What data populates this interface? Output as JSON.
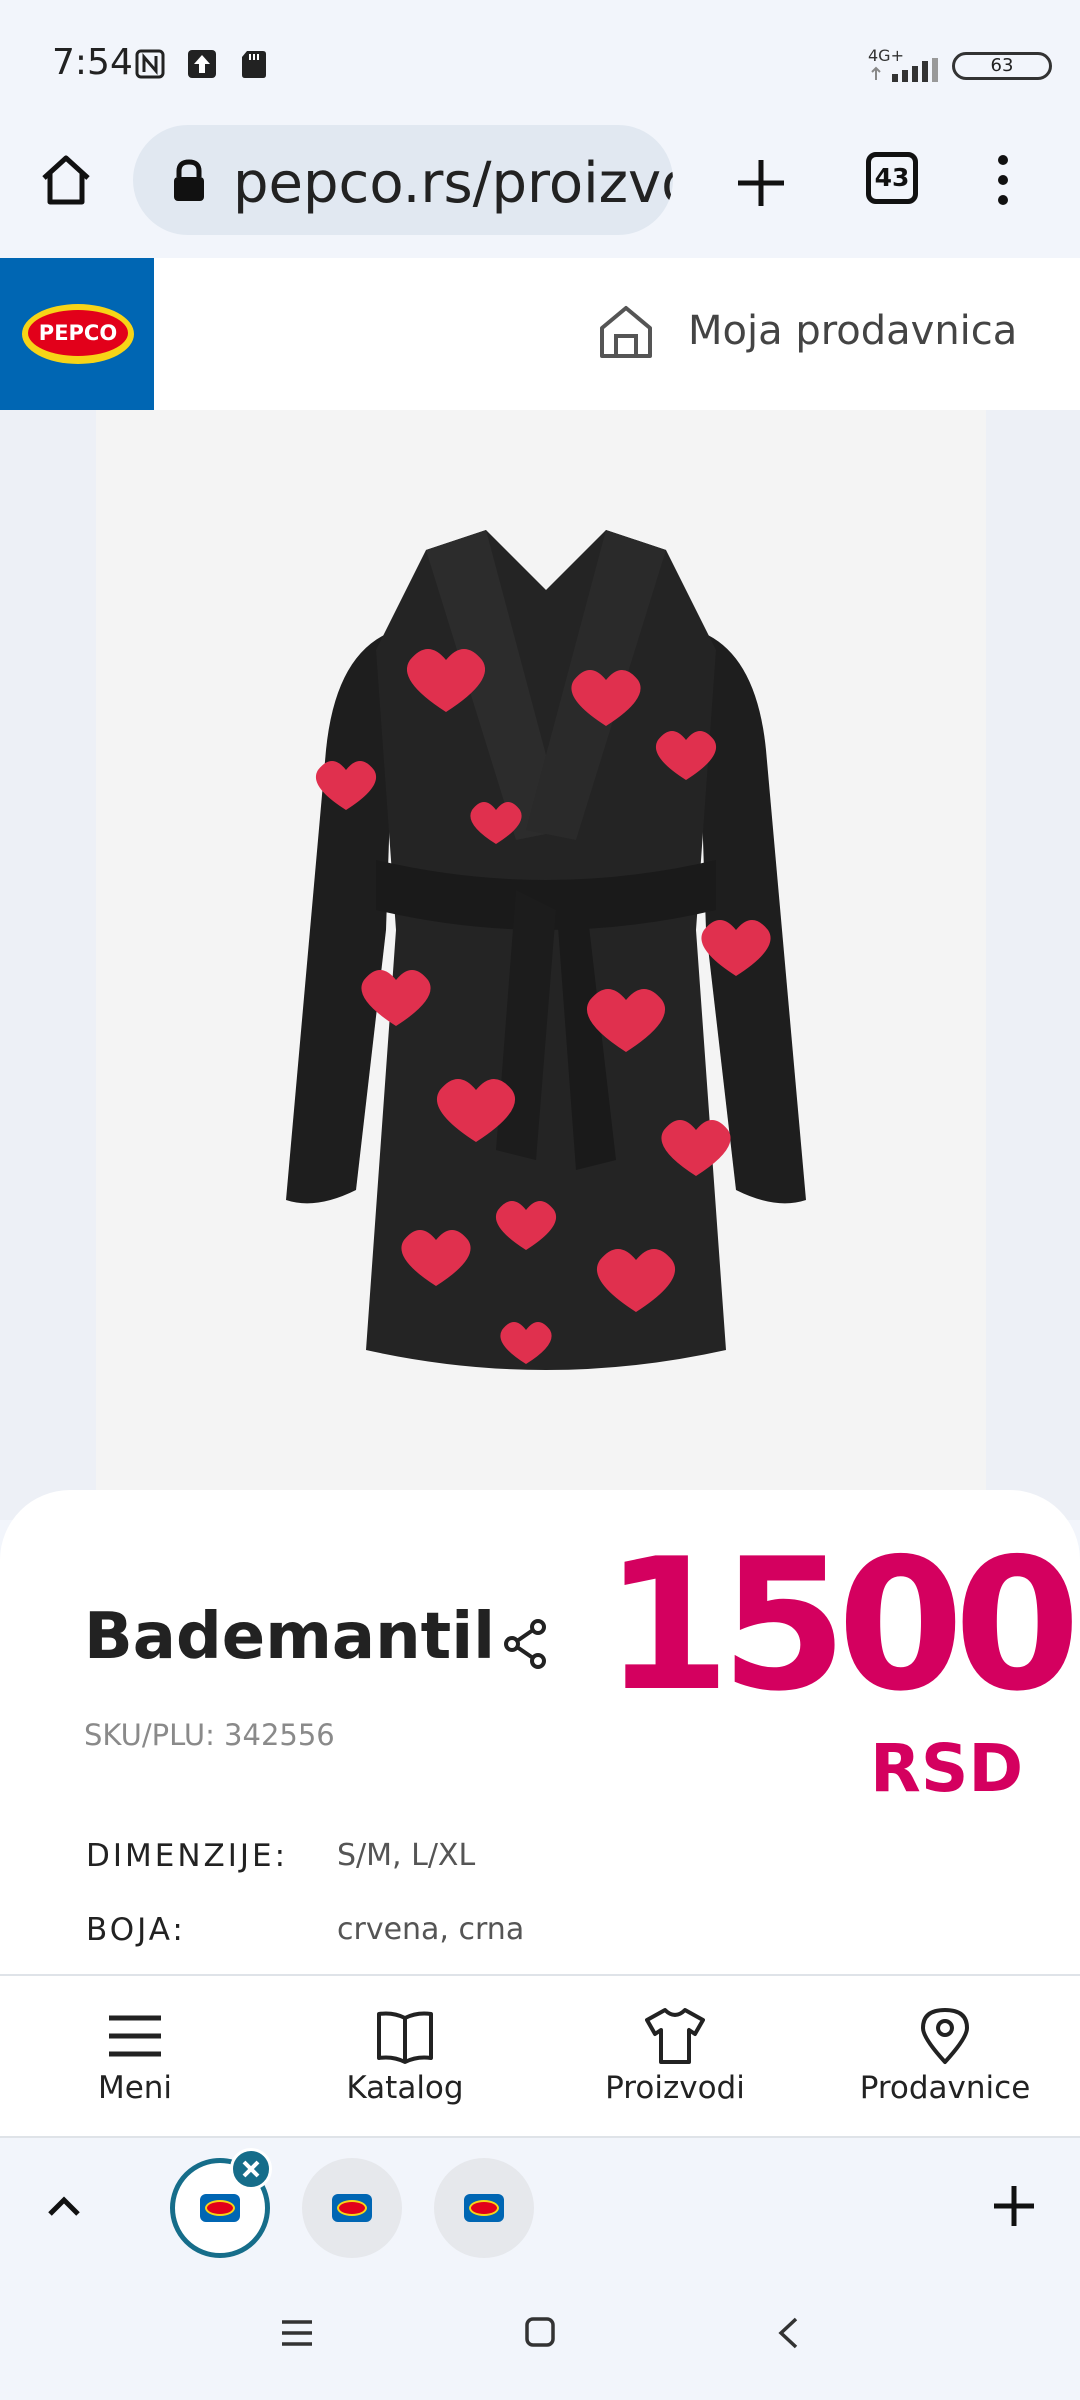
{
  "status_bar": {
    "time": "7:54",
    "network": "4G+",
    "battery": "63",
    "icons": [
      "nfc-icon",
      "upload-icon",
      "sd-card-icon",
      "signal-icon",
      "battery-icon"
    ]
  },
  "browser": {
    "url": "pepco.rs/proizvo",
    "tab_count": "43",
    "icons": [
      "home-icon",
      "lock-icon",
      "new-tab-icon",
      "tab-switcher-icon",
      "overflow-menu-icon"
    ]
  },
  "site_header": {
    "logo_text": "PEPCO",
    "store_label": "Moja prodavnica",
    "icons": [
      "store-home-icon"
    ]
  },
  "product": {
    "image_alt": "bathrobe-image",
    "title": "Bademantil",
    "sku": "SKU/PLU: 342556",
    "price": "1500",
    "currency": "RSD",
    "specs": [
      {
        "label": "DIMENZIJE:",
        "value": "S/M, L/XL"
      },
      {
        "label": "BOJA:",
        "value": "crvena, crna"
      }
    ]
  },
  "bottom_nav": [
    {
      "label": "Meni",
      "icon": "menu-icon"
    },
    {
      "label": "Katalog",
      "icon": "book-icon"
    },
    {
      "label": "Proizvodi",
      "icon": "tshirt-icon"
    },
    {
      "label": "Prodavnice",
      "icon": "location-pin-icon"
    }
  ],
  "tab_bar": {
    "icons": [
      "chevron-up-icon",
      "close-icon",
      "add-tab-icon"
    ]
  },
  "colors": {
    "brand_blue": "#0066b3",
    "brand_red": "#e2001a",
    "brand_yellow": "#f7d417",
    "price_pink": "#d4005f"
  }
}
